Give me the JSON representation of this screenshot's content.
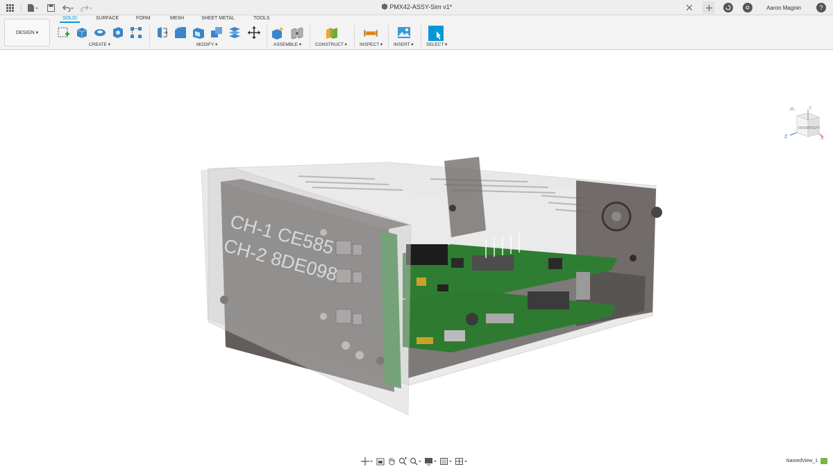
{
  "window": {
    "title": "PMX42-ASSY-Sim v1*",
    "user_name": "Aaron Magnin",
    "help_label": "?"
  },
  "workspace": {
    "label": "DESIGN ▾"
  },
  "ribbon": {
    "tabs": [
      {
        "label": "SOLID",
        "active": true
      },
      {
        "label": "SURFACE",
        "active": false
      },
      {
        "label": "FORM",
        "active": false
      },
      {
        "label": "MESH",
        "active": false
      },
      {
        "label": "SHEET METAL",
        "active": false
      },
      {
        "label": "TOOLS",
        "active": false
      }
    ],
    "groups": [
      {
        "label": "CREATE ▾"
      },
      {
        "label": "MODIFY ▾"
      },
      {
        "label": "ASSEMBLE ▾"
      },
      {
        "label": "CONSTRUCT ▾"
      },
      {
        "label": "INSPECT ▾"
      },
      {
        "label": "INSERT ▾"
      },
      {
        "label": "SELECT ▾"
      }
    ],
    "tool_icons": [
      "new-sketch-icon",
      "extrude-icon",
      "revolve-icon",
      "hole-icon",
      "pattern-icon",
      "press-pull-icon",
      "fillet-icon",
      "shell-icon",
      "combine-icon",
      "stack-icon",
      "move-icon",
      "new-component-icon",
      "joint-icon",
      "plane-icon",
      "measure-icon",
      "insert-image-icon",
      "select-icon"
    ]
  },
  "model": {
    "label_line1": "CH-1 CE585",
    "label_line2": "CH-2 8DE098"
  },
  "viewcube": {
    "front_label": "FRONT",
    "right_label": "RIGHT",
    "axis_y": "Y",
    "axis_z": "Z",
    "axis_x": "X"
  },
  "statusbar": {
    "named_view": "NamedView_1"
  },
  "colors": {
    "accent": "#0696d7",
    "pcb_green": "#2e7d32",
    "enclosure_gray": "#5a5452"
  }
}
